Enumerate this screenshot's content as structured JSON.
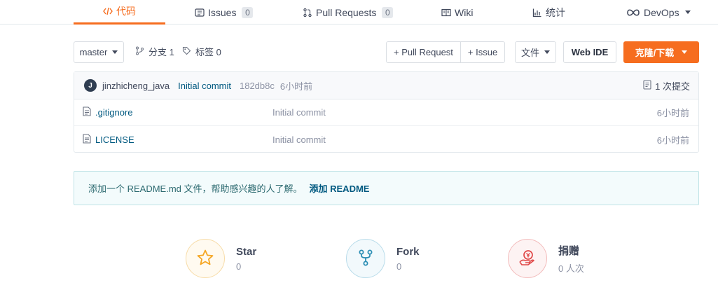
{
  "tabs": [
    {
      "label": "代码",
      "icon": "code-icon",
      "active": true
    },
    {
      "label": "Issues",
      "badge": "0",
      "icon": "issues-icon"
    },
    {
      "label": "Pull Requests",
      "badge": "0",
      "icon": "pull-request-icon"
    },
    {
      "label": "Wiki",
      "icon": "book-icon"
    },
    {
      "label": "统计",
      "icon": "bar-chart-icon"
    },
    {
      "label": "DevOps",
      "icon": "infinity-icon"
    }
  ],
  "toolbar": {
    "branch": "master",
    "branches_label": "分支 1",
    "tags_label": "标签 0",
    "pull_request": "+ Pull Request",
    "issue": "+ Issue",
    "file_menu": "文件",
    "web_ide": "Web IDE",
    "clone": "克隆/下载"
  },
  "commit": {
    "avatar_letter": "J",
    "author": "jinzhicheng_java",
    "message": "Initial commit",
    "hash": "182db8c",
    "time": "6小时前",
    "count": "1 次提交"
  },
  "files": [
    {
      "name": ".gitignore",
      "message": "Initial commit",
      "time": "6小时前"
    },
    {
      "name": "LICENSE",
      "message": "Initial commit",
      "time": "6小时前"
    }
  ],
  "readme_tip": {
    "text": "添加一个 README.md 文件，帮助感兴趣的人了解。",
    "action": "添加 README"
  },
  "stats": {
    "star": {
      "title": "Star",
      "value": "0"
    },
    "fork": {
      "title": "Fork",
      "value": "0"
    },
    "donate": {
      "title": "捐赠",
      "value": "0 人次"
    }
  },
  "colors": {
    "accent": "#f66d1f",
    "link": "#005980",
    "star": "#f5a623",
    "fork": "#2d8fb5",
    "donate": "#e04848"
  }
}
